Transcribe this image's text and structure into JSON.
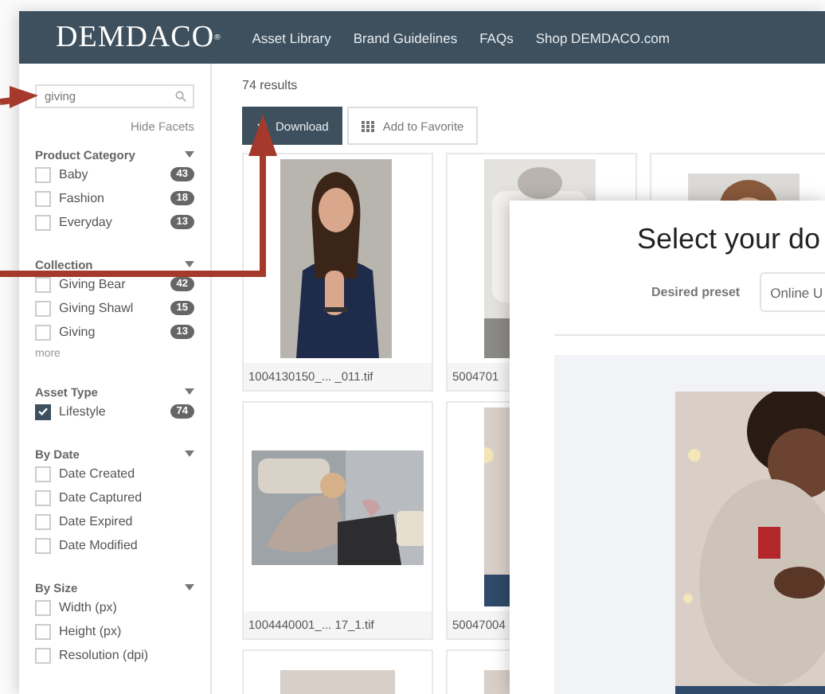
{
  "header": {
    "logo": "DEMDACO",
    "logo_mark": "®",
    "nav": [
      "Asset Library",
      "Brand Guidelines",
      "FAQs",
      "Shop DEMDACO.com"
    ]
  },
  "sidebar": {
    "search": {
      "value": "giving"
    },
    "hide_facets": "Hide Facets",
    "facets": [
      {
        "title": "Product Category",
        "options": [
          {
            "label": "Baby",
            "count": "43",
            "checked": false
          },
          {
            "label": "Fashion",
            "count": "18",
            "checked": false
          },
          {
            "label": "Everyday",
            "count": "13",
            "checked": false
          }
        ]
      },
      {
        "title": "Collection",
        "options": [
          {
            "label": "Giving Bear",
            "count": "42",
            "checked": false
          },
          {
            "label": "Giving Shawl",
            "count": "15",
            "checked": false
          },
          {
            "label": "Giving",
            "count": "13",
            "checked": false
          }
        ],
        "more": "more"
      },
      {
        "title": "Asset Type",
        "options": [
          {
            "label": "Lifestyle",
            "count": "74",
            "checked": true
          }
        ]
      },
      {
        "title": "By Date",
        "options": [
          {
            "label": "Date Created",
            "checked": false
          },
          {
            "label": "Date Captured",
            "checked": false
          },
          {
            "label": "Date Expired",
            "checked": false
          },
          {
            "label": "Date Modified",
            "checked": false
          }
        ]
      },
      {
        "title": "By Size",
        "options": [
          {
            "label": "Width (px)",
            "checked": false
          },
          {
            "label": "Height (px)",
            "checked": false
          },
          {
            "label": "Resolution (dpi)",
            "checked": false
          }
        ]
      }
    ]
  },
  "results": "74 results",
  "toolbar": [
    {
      "label": "Download",
      "kind": "primary"
    },
    {
      "label": "Add to Favorite",
      "kind": "secondary"
    }
  ],
  "asset_rows": [
    [
      {
        "kind": "picture",
        "caption": "1004130150_... _011.tif"
      },
      {
        "kind": "picture",
        "caption": "5004701"
      },
      {
        "kind": "picture"
      }
    ],
    [
      {
        "kind": "picture",
        "caption": "1004440001_... 17_1.tif"
      },
      {
        "kind": "picture",
        "caption": "50047004"
      }
    ],
    [
      {
        "kind": "picture"
      },
      {
        "kind": "picture"
      }
    ]
  ],
  "modal": {
    "title": "Select your do",
    "preset_label": "Desired preset",
    "preset_value": "Online U"
  }
}
